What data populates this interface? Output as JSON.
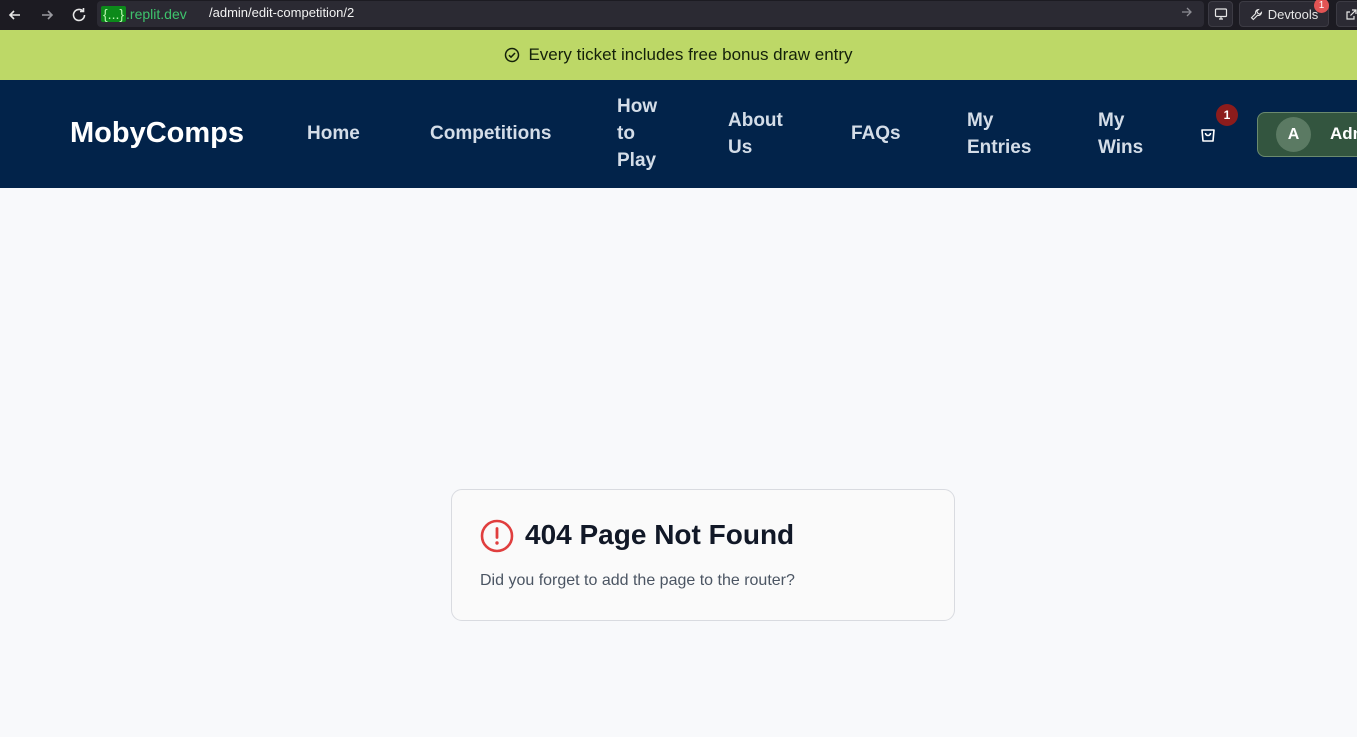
{
  "browser": {
    "url_domain_highlight": "{...}",
    "url_domain_rest": ".replit.dev",
    "url_path": "/admin/edit-competition/2",
    "devtools_label": "Devtools",
    "devtools_badge": "1"
  },
  "promo": {
    "text": "Every ticket includes free bonus draw entry",
    "icon": "check-circle-icon"
  },
  "header": {
    "logo": "MobyComps",
    "nav": {
      "home": "Home",
      "competitions": "Competitions",
      "how_to_play_1": "How",
      "how_to_play_2": "to",
      "how_to_play_3": "Play",
      "about_1": "About",
      "about_2": "Us",
      "faqs": "FAQs",
      "my_entries_1": "My",
      "my_entries_2": "Entries",
      "my_wins_1": "My",
      "my_wins_2": "Wins"
    },
    "cart_count": "1",
    "avatar_initial": "A",
    "account_label": "Admin"
  },
  "not_found": {
    "title": "404 Page Not Found",
    "message": "Did you forget to add the page to the router?"
  },
  "colors": {
    "promo_bg": "#bdd867",
    "header_bg": "#02234a",
    "error_icon": "#e03e3e",
    "cart_badge": "#8c1c1c"
  }
}
